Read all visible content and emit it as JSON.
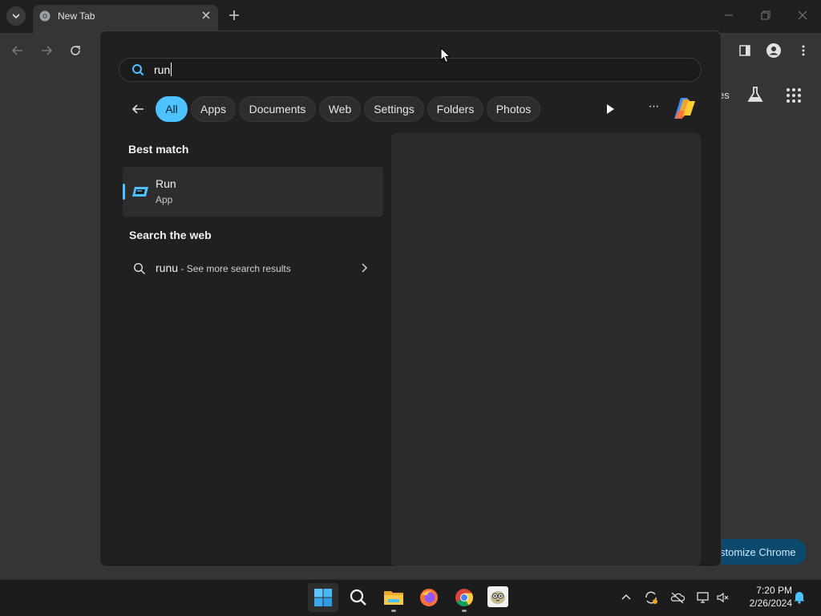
{
  "browser": {
    "tab_title": "New Tab",
    "customize_label": "stomize Chrome",
    "partial_shortcut_label": "es"
  },
  "search": {
    "query": "run"
  },
  "filters": {
    "items": [
      {
        "label": "All",
        "active": true
      },
      {
        "label": "Apps"
      },
      {
        "label": "Documents"
      },
      {
        "label": "Web"
      },
      {
        "label": "Settings"
      },
      {
        "label": "Folders"
      },
      {
        "label": "Photos"
      }
    ],
    "more_label": "···"
  },
  "results": {
    "best_match_heading": "Best match",
    "best_match": {
      "name": "Run",
      "type": "App"
    },
    "web_heading": "Search the web",
    "web_item": {
      "query": "runu",
      "suffix": " - See more search results"
    }
  },
  "taskbar": {
    "time": "7:20 PM",
    "date": "2/26/2024"
  },
  "colors": {
    "accent": "#4cc2ff",
    "flyout_bg": "#202020",
    "preview_bg": "#2b2b2b",
    "chrome_bg": "#353535"
  }
}
